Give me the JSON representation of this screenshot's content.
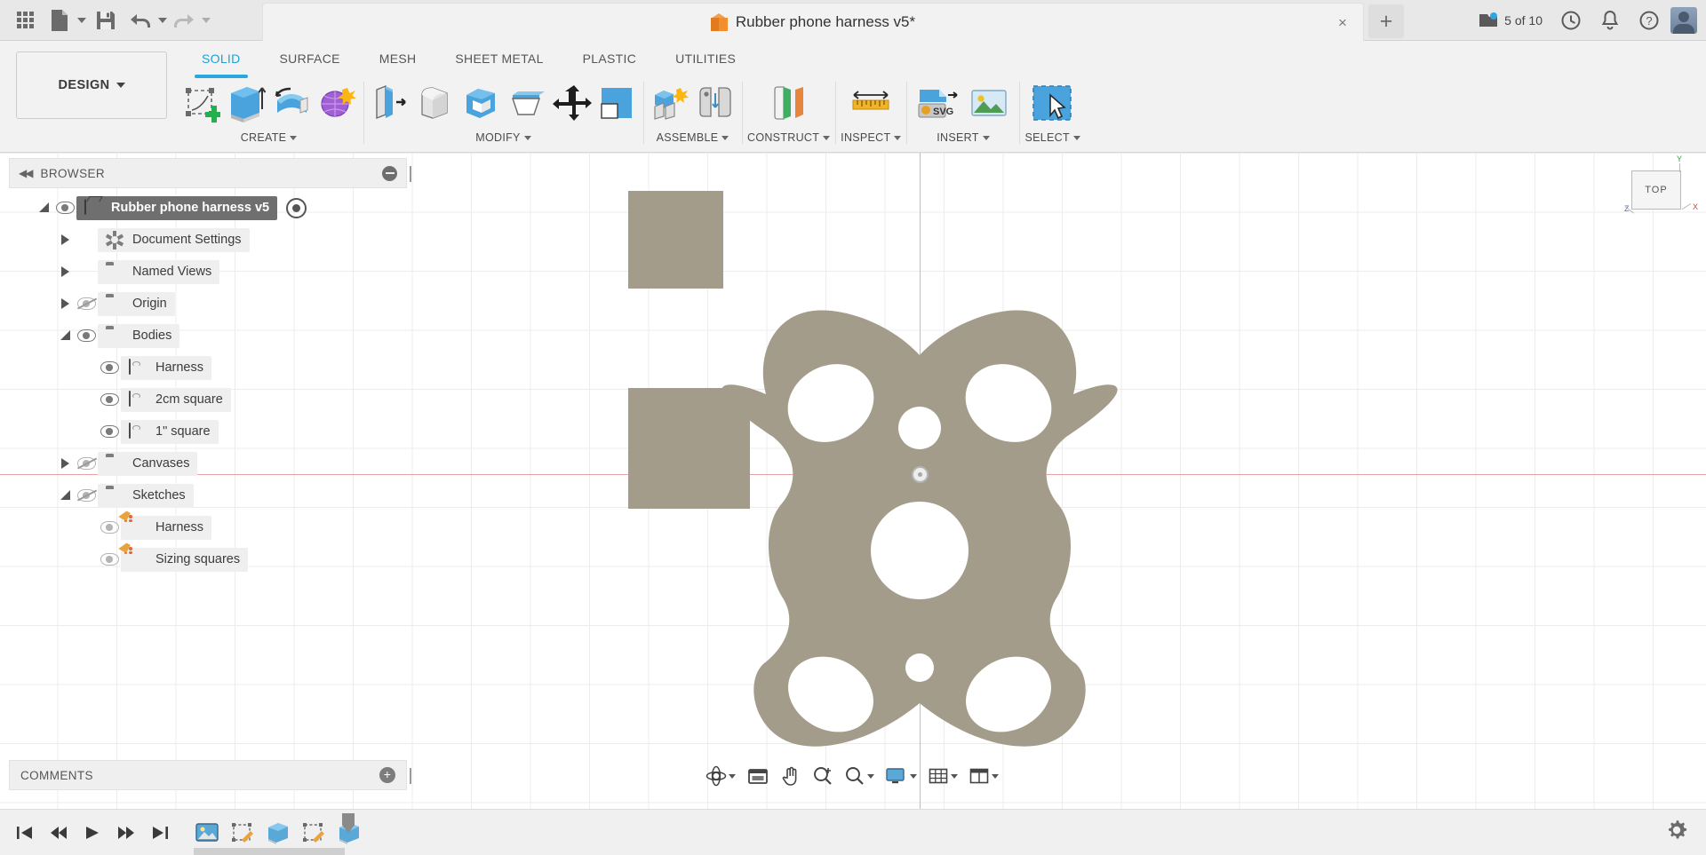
{
  "titlebar": {
    "doc_title": "Rubber phone harness v5*",
    "close_label": "×",
    "new_tab_label": "+",
    "jobs_status": "5 of 10",
    "icons": {
      "apps": "grid-apps-icon",
      "new_file": "new-file-icon",
      "save": "save-icon",
      "undo": "undo-icon",
      "redo": "redo-icon",
      "jobs": "jobs-icon",
      "history": "clock-history-icon",
      "notifications": "bell-icon",
      "help": "help-icon",
      "account": "user-avatar"
    }
  },
  "ribbon": {
    "workspace": "DESIGN",
    "tabs": [
      {
        "label": "SOLID",
        "active": true
      },
      {
        "label": "SURFACE",
        "active": false
      },
      {
        "label": "MESH",
        "active": false
      },
      {
        "label": "SHEET METAL",
        "active": false
      },
      {
        "label": "PLASTIC",
        "active": false
      },
      {
        "label": "UTILITIES",
        "active": false
      }
    ],
    "panels": [
      {
        "label": "CREATE",
        "buttons": [
          {
            "name": "create-sketch-button",
            "icon": "create-sketch-icon"
          },
          {
            "name": "extrude-button",
            "icon": "extrude-icon"
          },
          {
            "name": "revolve-button",
            "icon": "revolve-icon"
          },
          {
            "name": "form-button",
            "icon": "form-sculpt-icon"
          }
        ]
      },
      {
        "label": "MODIFY",
        "buttons": [
          {
            "name": "press-pull-button",
            "icon": "press-pull-icon"
          },
          {
            "name": "fillet-button",
            "icon": "fillet-icon"
          },
          {
            "name": "shell-button",
            "icon": "shell-icon"
          },
          {
            "name": "draft-button",
            "icon": "draft-icon"
          },
          {
            "name": "move-copy-button",
            "icon": "move-copy-icon"
          },
          {
            "name": "align-button",
            "icon": "align-icon"
          }
        ]
      },
      {
        "label": "ASSEMBLE",
        "buttons": [
          {
            "name": "new-component-button",
            "icon": "new-component-icon"
          },
          {
            "name": "joint-button",
            "icon": "joint-icon"
          }
        ]
      },
      {
        "label": "CONSTRUCT",
        "buttons": [
          {
            "name": "offset-plane-button",
            "icon": "offset-plane-icon"
          }
        ]
      },
      {
        "label": "INSPECT",
        "buttons": [
          {
            "name": "measure-button",
            "icon": "measure-ruler-icon"
          }
        ]
      },
      {
        "label": "INSERT",
        "buttons": [
          {
            "name": "insert-svg-button",
            "icon": "insert-svg-icon"
          },
          {
            "name": "insert-canvas-button",
            "icon": "insert-canvas-icon"
          }
        ]
      },
      {
        "label": "SELECT",
        "buttons": [
          {
            "name": "select-tool-button",
            "icon": "select-cursor-icon"
          }
        ]
      }
    ]
  },
  "browser": {
    "title": "BROWSER",
    "collapse_icon": "collapse-left-icon",
    "minimize_icon": "minimize-icon",
    "tree": [
      {
        "label": "Rubber phone harness v5",
        "indent": 0,
        "twisty": "open",
        "eye": "visible",
        "icon": "component-box-icon",
        "selected": true,
        "target": true
      },
      {
        "label": "Document Settings",
        "indent": 1,
        "twisty": "closed",
        "eye": "none",
        "icon": "gear-icon",
        "selected": false,
        "target": false
      },
      {
        "label": "Named Views",
        "indent": 1,
        "twisty": "closed",
        "eye": "none",
        "icon": "folder-icon",
        "selected": false,
        "target": false
      },
      {
        "label": "Origin",
        "indent": 1,
        "twisty": "closed",
        "eye": "hidden",
        "icon": "folder-icon",
        "selected": false,
        "target": false
      },
      {
        "label": "Bodies",
        "indent": 1,
        "twisty": "open",
        "eye": "visible",
        "icon": "folder-icon",
        "selected": false,
        "target": false
      },
      {
        "label": "Harness",
        "indent": 2,
        "twisty": "none",
        "eye": "visible",
        "icon": "body-icon",
        "selected": false,
        "target": false
      },
      {
        "label": "2cm square",
        "indent": 2,
        "twisty": "none",
        "eye": "visible",
        "icon": "body-icon",
        "selected": false,
        "target": false
      },
      {
        "label": "1\" square",
        "indent": 2,
        "twisty": "none",
        "eye": "visible",
        "icon": "body-icon",
        "selected": false,
        "target": false
      },
      {
        "label": "Canvases",
        "indent": 1,
        "twisty": "closed",
        "eye": "hidden",
        "icon": "folder-icon",
        "selected": false,
        "target": false
      },
      {
        "label": "Sketches",
        "indent": 1,
        "twisty": "open",
        "eye": "hidden",
        "icon": "folder-icon",
        "selected": false,
        "target": false
      },
      {
        "label": "Harness",
        "indent": 2,
        "twisty": "none",
        "eye": "dim",
        "icon": "sketch-icon",
        "selected": false,
        "target": false
      },
      {
        "label": "Sizing squares",
        "indent": 2,
        "twisty": "none",
        "eye": "dim",
        "icon": "sketch-icon",
        "selected": false,
        "target": false
      }
    ]
  },
  "comments": {
    "title": "COMMENTS",
    "add_label": "+"
  },
  "viewport": {
    "viewcube_face": "TOP",
    "axis_labels": {
      "x": "X",
      "y": "Y",
      "z": "Z"
    },
    "model_color": "#a39c8a",
    "grid_color": "#ececec",
    "x_axis_color": "#e8a0a0",
    "y_axis_color": "#9fd39f",
    "bodies": [
      {
        "name": "harness-shape",
        "color": "#a39c8a"
      },
      {
        "name": "square-1inch",
        "color": "#a39c8a"
      },
      {
        "name": "square-2cm",
        "color": "#a39c8a"
      }
    ]
  },
  "navbar": {
    "buttons": [
      {
        "name": "orbit-button",
        "icon": "orbit-icon",
        "caret": true
      },
      {
        "name": "look-at-button",
        "icon": "look-at-icon",
        "caret": false
      },
      {
        "name": "pan-button",
        "icon": "pan-hand-icon",
        "caret": false
      },
      {
        "name": "zoom-button",
        "icon": "zoom-icon",
        "caret": false
      },
      {
        "name": "zoom-window-button",
        "icon": "zoom-window-icon",
        "caret": true
      },
      {
        "name": "display-settings-button",
        "icon": "display-settings-icon",
        "caret": true
      },
      {
        "name": "grid-snaps-button",
        "icon": "grid-snaps-icon",
        "caret": true
      },
      {
        "name": "viewports-button",
        "icon": "viewports-icon",
        "caret": true
      }
    ]
  },
  "timeline": {
    "buttons": [
      {
        "name": "timeline-begin-button",
        "icon": "skip-to-start-icon"
      },
      {
        "name": "timeline-step-back-button",
        "icon": "step-back-icon"
      },
      {
        "name": "timeline-play-button",
        "icon": "play-icon"
      },
      {
        "name": "timeline-step-fwd-button",
        "icon": "step-forward-icon"
      },
      {
        "name": "timeline-end-button",
        "icon": "skip-to-end-icon"
      }
    ],
    "features": [
      {
        "name": "timeline-feature-canvas",
        "icon": "canvas-feature-icon"
      },
      {
        "name": "timeline-feature-sketch-1",
        "icon": "sketch-feature-icon"
      },
      {
        "name": "timeline-feature-extrude-1",
        "icon": "extrude-feature-icon"
      },
      {
        "name": "timeline-feature-sketch-2",
        "icon": "sketch-feature-icon"
      },
      {
        "name": "timeline-feature-extrude-2",
        "icon": "extrude-feature-icon"
      }
    ],
    "settings_icon": "settings-gear-icon"
  }
}
